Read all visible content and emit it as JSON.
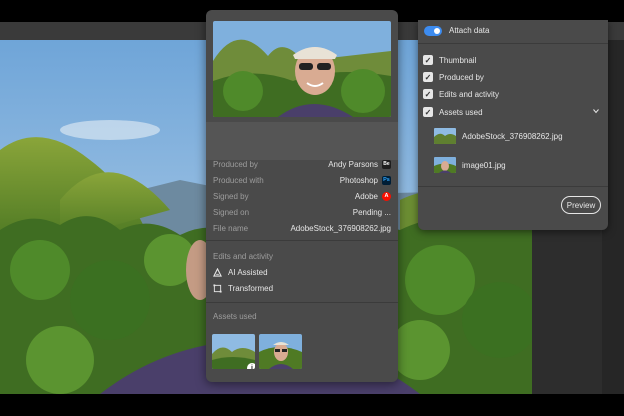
{
  "center_panel": {
    "meta": [
      {
        "key": "Produced by",
        "value": "Andy Parsons",
        "badge": "Be"
      },
      {
        "key": "Produced with",
        "value": "Photoshop",
        "badge": "Ps"
      },
      {
        "key": "Signed by",
        "value": "Adobe",
        "badge": "A"
      },
      {
        "key": "Signed on",
        "value": "Pending ..."
      },
      {
        "key": "File name",
        "value": "AdobeStock_376908262.jpg"
      }
    ],
    "edits_title": "Edits and activity",
    "edits": [
      "AI Assisted",
      "Transformed"
    ],
    "assets_title": "Assets used",
    "info_glyph": "i"
  },
  "right_panel": {
    "attach_label": "Attach data",
    "attach_on": true,
    "options": [
      {
        "label": "Thumbnail",
        "checked": true
      },
      {
        "label": "Produced by",
        "checked": true
      },
      {
        "label": "Edits and activity",
        "checked": true
      },
      {
        "label": "Assets used",
        "checked": true
      }
    ],
    "assets": [
      "AdobeStock_376908262.jpg",
      "image01.jpg"
    ],
    "preview_label": "Preview"
  },
  "icons": {
    "ai": "ai-assisted-icon",
    "transform": "transform-icon",
    "check": "checkmark-icon",
    "chevron": "chevron-down-icon"
  },
  "colors": {
    "toggle_on": "#3d8cf0",
    "adobe_red": "#fa0f00",
    "panel_bg": "#4a4a4a"
  }
}
